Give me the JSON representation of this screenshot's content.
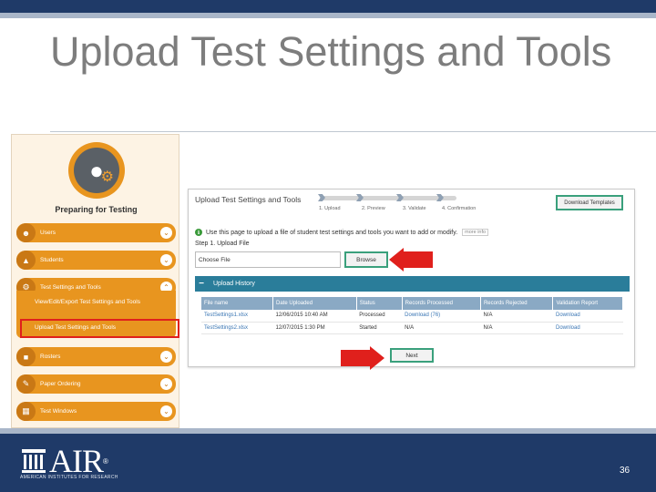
{
  "slide": {
    "title": "Upload Test Settings and Tools",
    "page_number": "36"
  },
  "sidebar": {
    "title": "Preparing for Testing",
    "items": [
      {
        "label": "Users",
        "icon": "users-icon"
      },
      {
        "label": "Students",
        "icon": "graduation-cap-icon"
      },
      {
        "label": "Test Settings and Tools",
        "icon": "settings-icon"
      },
      {
        "label": "Rosters",
        "icon": "roster-icon"
      },
      {
        "label": "Paper Ordering",
        "icon": "paper-icon"
      },
      {
        "label": "Test Windows",
        "icon": "calendar-icon"
      }
    ],
    "subitems": [
      "View/Edit/Export Test Settings and Tools",
      "Upload Test Settings and Tools"
    ]
  },
  "panel": {
    "title": "Upload Test Settings and Tools",
    "steps": [
      "1. Upload",
      "2. Preview",
      "3. Validate",
      "4. Confirmation"
    ],
    "download_templates": "Download Templates",
    "info_text": "Use this page to upload a file of student test settings and tools you want to add or modify.",
    "more_info": "more info",
    "step_heading": "Step 1. Upload File",
    "choose_file": "Choose File",
    "browse": "Browse",
    "history_title": "Upload History",
    "history_columns": [
      "File name",
      "Date Uploaded",
      "Status",
      "Records Processed",
      "Records Rejected",
      "Validation Report"
    ],
    "history_rows": [
      [
        "TestSettings1.xlsx",
        "12/06/2015 10:40 AM",
        "Processed",
        "Download (76)",
        "N/A",
        "Download"
      ],
      [
        "TestSettings2.xlsx",
        "12/07/2015 1:30 PM",
        "Started",
        "N/A",
        "N/A",
        "Download"
      ]
    ],
    "next": "Next"
  },
  "footer": {
    "logo_text": "AIR",
    "logo_sub": "AMERICAN INSTITUTES FOR RESEARCH"
  },
  "colors": {
    "navy": "#1f3a68",
    "orange": "#e8951f",
    "teal_header": "#2a7d9a",
    "highlight_red": "#e0201c",
    "button_green": "#3aa07c"
  }
}
